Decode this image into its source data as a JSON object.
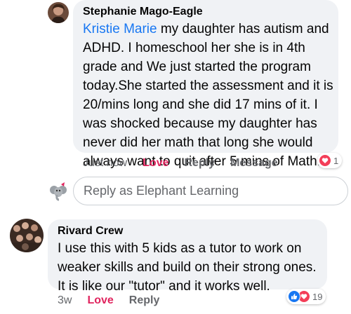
{
  "comments": [
    {
      "author": "Stephanie Mago-Eagle",
      "mention": "Kristie Marie",
      "text": " my daughter has autism and ADHD. I homeschool her she is in 4th grade and We just started the program today.She started the assessment and it is 20/mins long and she did 17 mins of it. I was shocked because my daughter has never did her math that long she would always want to quit after 5 mins of Math.",
      "timestamp": "Just now",
      "actions": [
        "Love",
        "Reply",
        "Message"
      ],
      "reactions": {
        "icons": [
          "heart-icon"
        ],
        "count": "1"
      }
    },
    {
      "author": "Rivard Crew",
      "text": "I use this with 5 kids as a tutor to work on weaker skills and build on their strong ones. It is like our \"tutor\" and it works well.",
      "timestamp": "3w",
      "actions": [
        "Love",
        "Reply"
      ],
      "reactions": {
        "icons": [
          "like-icon",
          "heart-icon"
        ],
        "count": "19"
      }
    }
  ],
  "reply_box": {
    "placeholder": "Reply as Elephant Learning"
  },
  "colors": {
    "bubble": "#f0f2f5",
    "love": "#e0245e",
    "mention": "#1877f2",
    "like": "#1877f2",
    "heart": "#f33e58"
  }
}
